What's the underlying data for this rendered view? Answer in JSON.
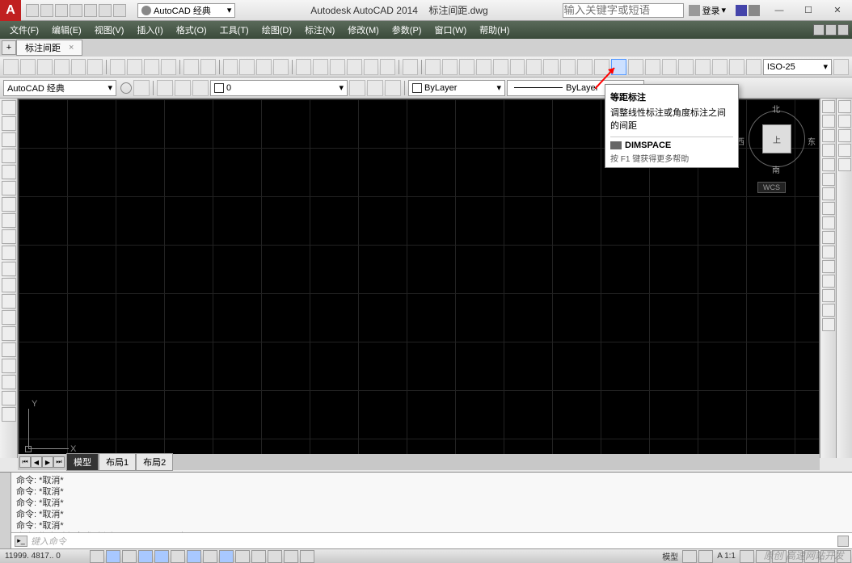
{
  "app": {
    "title_left": "Autodesk AutoCAD 2014",
    "title_doc": "标注间距.dwg",
    "workspace": "AutoCAD 经典",
    "search_placeholder": "输入关键字或短语",
    "signin": "登录"
  },
  "menus": [
    "文件(F)",
    "编辑(E)",
    "视图(V)",
    "插入(I)",
    "格式(O)",
    "工具(T)",
    "绘图(D)",
    "标注(N)",
    "修改(M)",
    "参数(P)",
    "窗口(W)",
    "帮助(H)"
  ],
  "doc_tab": "标注间距",
  "row2": {
    "workspace": "AutoCAD 经典",
    "layer": "0",
    "bylayer1": "ByLayer",
    "bylayer2": "ByLayer",
    "dimstyle": "ISO-25"
  },
  "tooltip": {
    "title": "等距标注",
    "desc": "调整线性标注或角度标注之间的间距",
    "cmd": "DIMSPACE",
    "hint": "按 F1 键获得更多帮助"
  },
  "viewcube": {
    "n": "北",
    "s": "南",
    "e": "东",
    "w": "西",
    "face": "上",
    "wcs": "WCS"
  },
  "ucs": {
    "x": "X",
    "y": "Y"
  },
  "layouts": [
    "模型",
    "布局1",
    "布局2"
  ],
  "cmd": {
    "history": [
      "命令: *取消*",
      "命令: *取消*",
      "命令: *取消*",
      "命令: *取消*",
      "命令: *取消*",
      "命令: 指定对角点或 [栏选(F)/圈围(WP)/圈交(CP)]:"
    ],
    "prompt": "键入命令"
  },
  "status": {
    "coords": "11999. 4817.. 0",
    "model": "模型",
    "scale": "A 1:1",
    "watermark": "原创 高速网站开发"
  }
}
